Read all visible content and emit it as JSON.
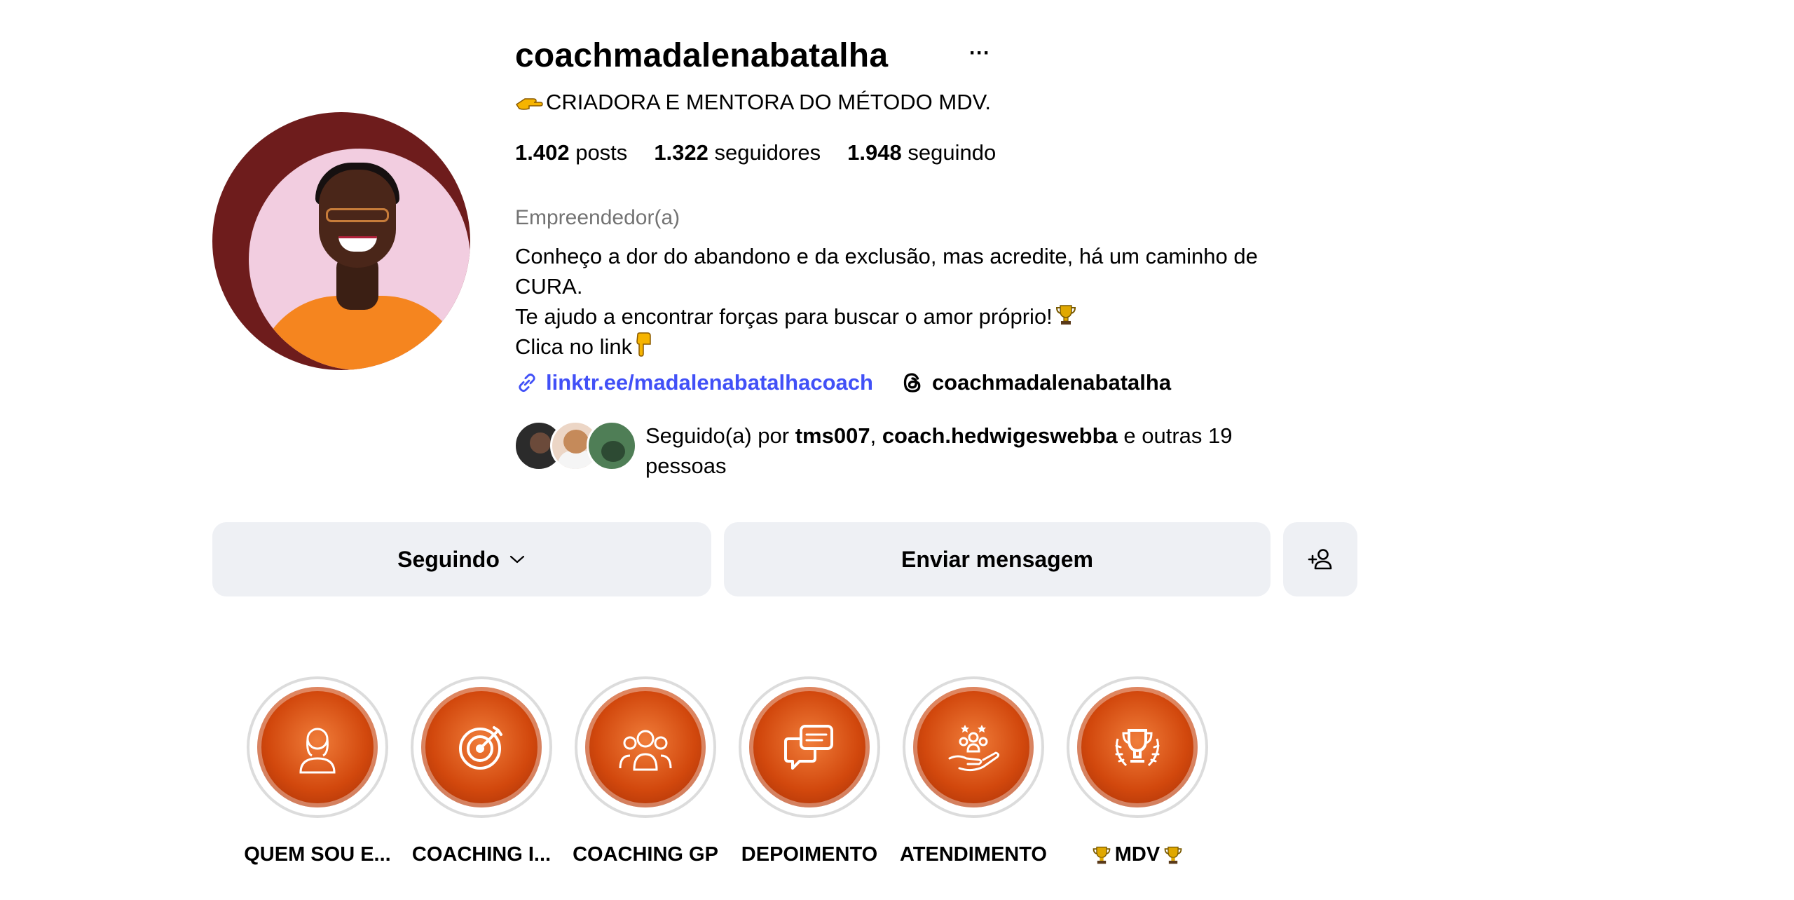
{
  "profile": {
    "username": "coachmadalenabatalha",
    "more_label": "···",
    "tagline": "CRIADORA E MENTORA DO MÉTODO MDV.",
    "stats": {
      "posts_count": "1.402",
      "posts_label": "posts",
      "followers_count": "1.322",
      "followers_label": "seguidores",
      "following_count": "1.948",
      "following_label": "seguindo"
    },
    "category": "Empreendedor(a)",
    "bio": {
      "line1": "Conheço a dor do abandono e da exclusão, mas acredite, há um caminho de",
      "line2": "CURA.",
      "line3": "Te ajudo a encontrar forças para buscar o amor próprio!",
      "line4": "Clica no link"
    },
    "link": "linktr.ee/madalenabatalhacoach",
    "threads_handle": "coachmadalenabatalha",
    "followed_by": {
      "prefix": "Seguido(a) por",
      "user1": "tms007",
      "sep": ",",
      "user2": "coach.hedwigeswebba",
      "suffix": "e outras 19",
      "line2": "pessoas"
    }
  },
  "actions": {
    "following_label": "Seguindo",
    "message_label": "Enviar mensagem"
  },
  "highlights": [
    {
      "label": "QUEM SOU E...",
      "icon": "woman-icon"
    },
    {
      "label": "COACHING I...",
      "icon": "target-icon"
    },
    {
      "label": "COACHING GP",
      "icon": "group-icon"
    },
    {
      "label": "DEPOIMENTO",
      "icon": "chat-icon"
    },
    {
      "label": "ATENDIMENTO",
      "icon": "hand-people-icon"
    },
    {
      "label": "MDV",
      "icon": "trophy-icon"
    }
  ],
  "colors": {
    "link": "#4150f7",
    "button_bg": "#eef0f4",
    "highlight_orange": "#d2480d",
    "avatar_ring": "#6e1c1c"
  }
}
